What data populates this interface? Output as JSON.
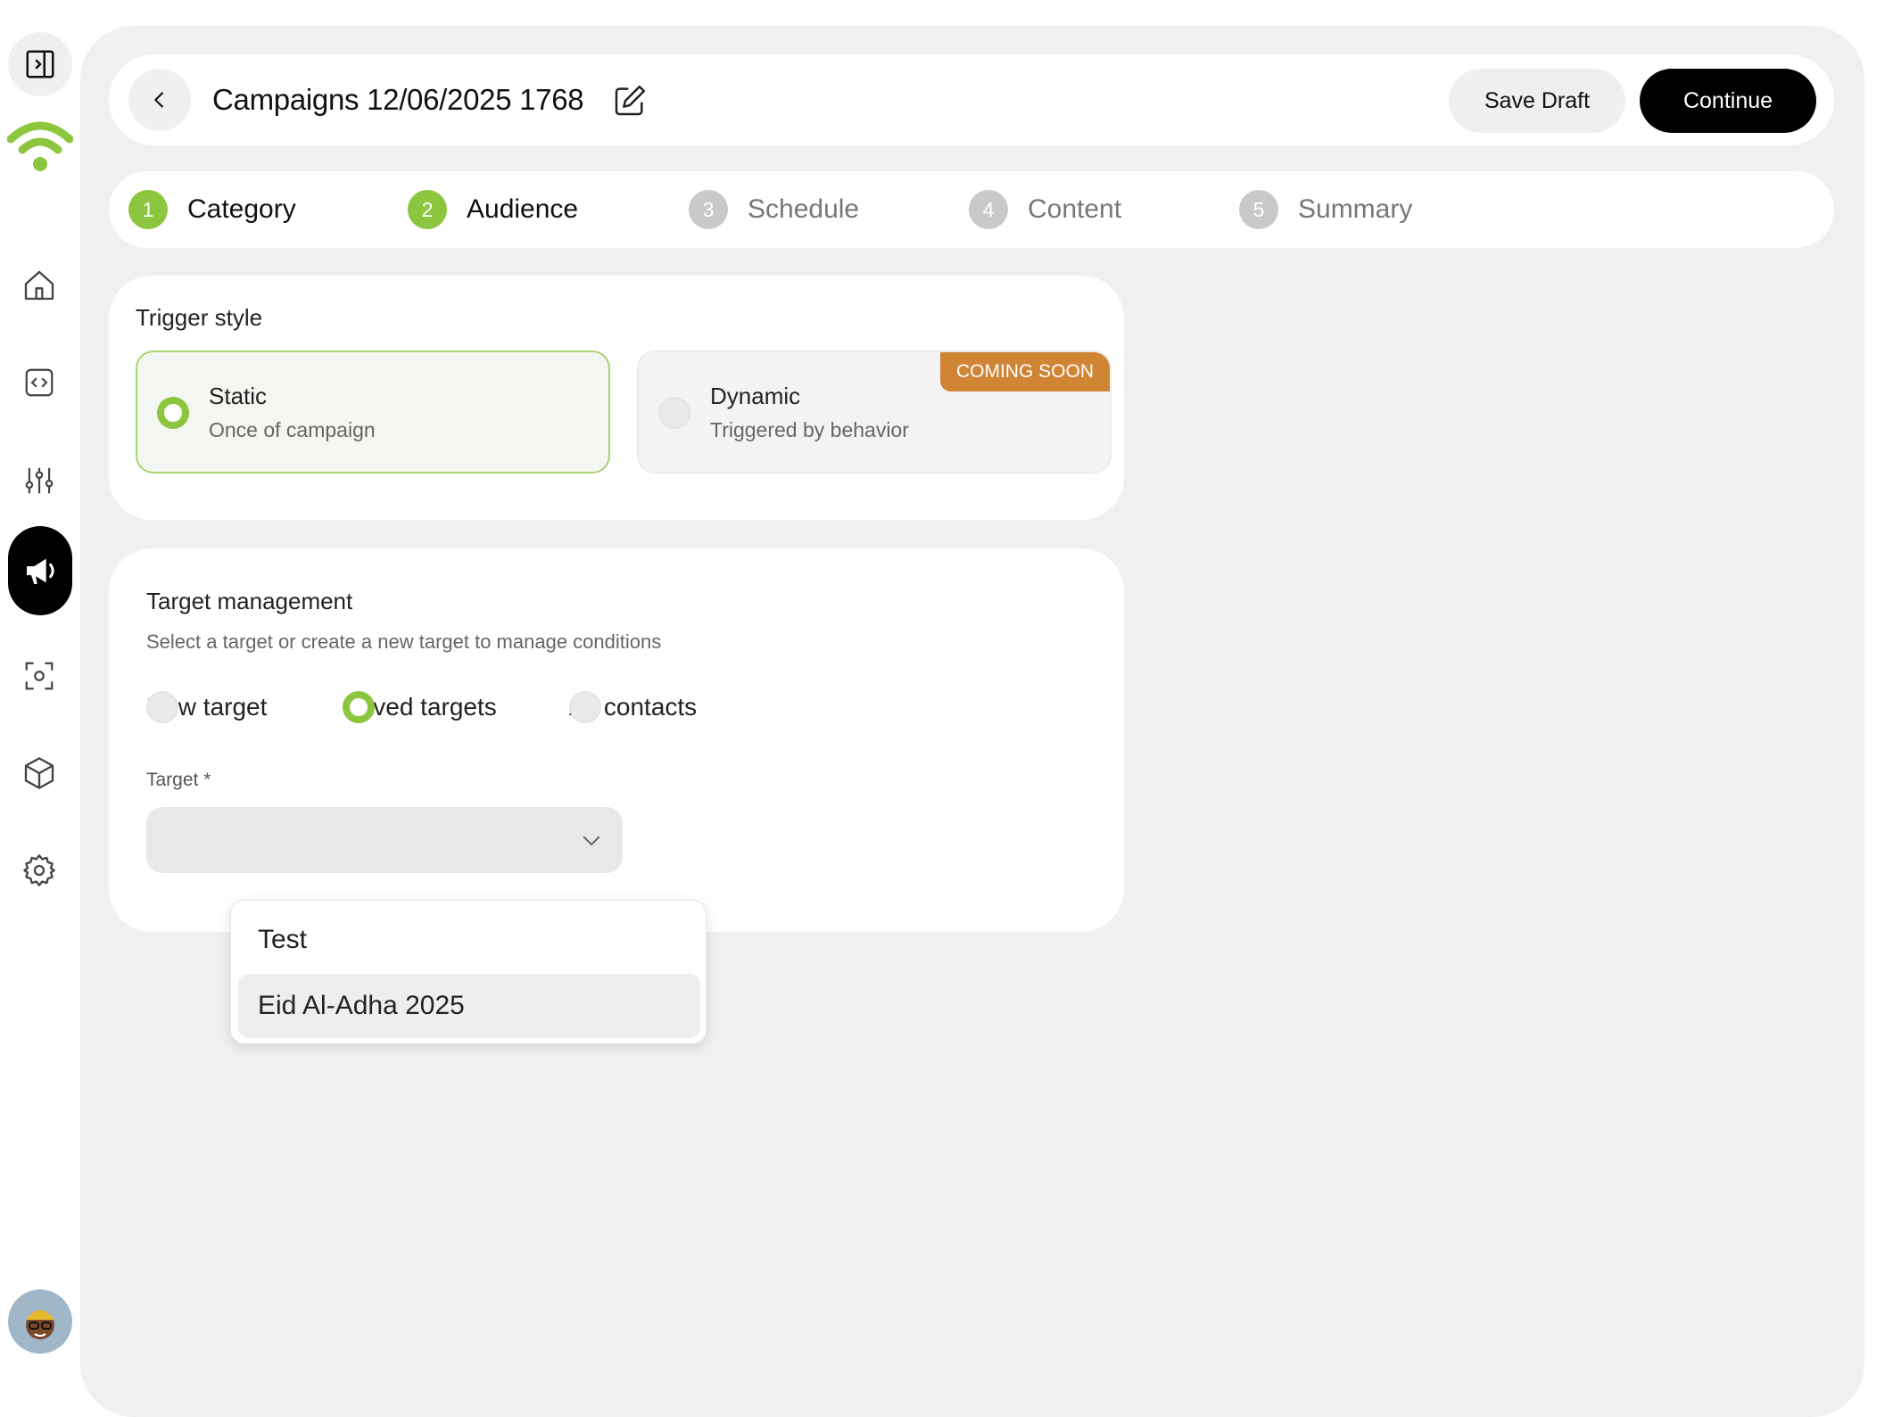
{
  "sidebar": {
    "items": [
      {
        "name": "sidebar-toggle",
        "icon": "panel-right-icon"
      },
      {
        "name": "home",
        "icon": "home-icon"
      },
      {
        "name": "code",
        "icon": "code-icon"
      },
      {
        "name": "settings-sliders",
        "icon": "sliders-icon"
      },
      {
        "name": "campaigns",
        "icon": "megaphone-icon",
        "active": true
      },
      {
        "name": "scan",
        "icon": "scan-icon"
      },
      {
        "name": "products",
        "icon": "box-icon"
      },
      {
        "name": "settings",
        "icon": "gear-icon"
      }
    ],
    "brand_color": "#8cc63f"
  },
  "header": {
    "title": "Campaigns 12/06/2025 1768",
    "save_label": "Save Draft",
    "continue_label": "Continue"
  },
  "steps": [
    {
      "number": "1",
      "label": "Category",
      "state": "done"
    },
    {
      "number": "2",
      "label": "Audience",
      "state": "done"
    },
    {
      "number": "3",
      "label": "Schedule",
      "state": "todo"
    },
    {
      "number": "4",
      "label": "Content",
      "state": "todo"
    },
    {
      "number": "5",
      "label": "Summary",
      "state": "todo"
    }
  ],
  "trigger": {
    "title": "Trigger style",
    "options": [
      {
        "title": "Static",
        "subtitle": "Once of campaign",
        "selected": true
      },
      {
        "title": "Dynamic",
        "subtitle": "Triggered by behavior",
        "selected": false,
        "badge": "COMING SOON"
      }
    ]
  },
  "target": {
    "title": "Target management",
    "subtitle": "Select a target or create a new target to manage conditions",
    "radios": [
      {
        "label": "New target",
        "selected": false
      },
      {
        "label": "Saved targets",
        "selected": true
      },
      {
        "label": "All contacts",
        "selected": false
      }
    ],
    "field_label": "Target *",
    "select_value": "",
    "dropdown_options": [
      {
        "label": "Test",
        "highlighted": false
      },
      {
        "label": "Eid Al-Adha 2025",
        "highlighted": true
      }
    ]
  },
  "colors": {
    "accent": "#8cc63f",
    "badge": "#d08535",
    "primary_button": "#000000"
  }
}
